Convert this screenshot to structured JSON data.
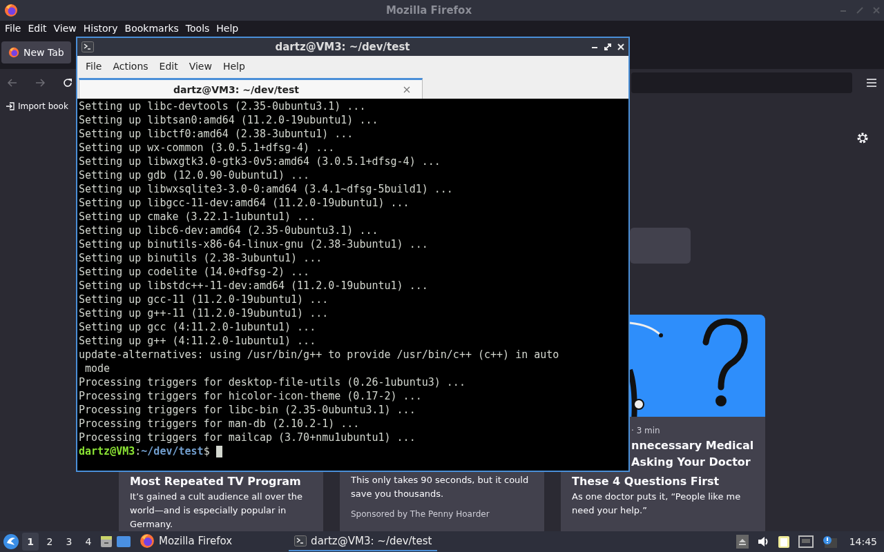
{
  "firefox": {
    "title": "Mozilla Firefox",
    "menu": [
      "File",
      "Edit",
      "View",
      "History",
      "Bookmarks",
      "Tools",
      "Help"
    ],
    "tabs": [
      {
        "label": "New Tab",
        "selected": true
      }
    ],
    "bookmarks": [
      {
        "label": "Import book"
      }
    ],
    "cards": [
      {
        "title_lines": [
          "Most Repeated TV Program"
        ],
        "text": "It’s gained a cult audience all over the world—and is especially popular in Germany.",
        "picture": false
      },
      {
        "text": "This only takes 90 seconds, but it could save you thousands.",
        "sponsor": "Sponsored by The Penny Hoarder",
        "picture": false
      },
      {
        "meta": "· 3 min",
        "cut_lines": [
          "nnecessary Medical",
          "Asking Your Doctor"
        ],
        "title_lines": [
          "These 4 Questions First"
        ],
        "text": "As one doctor puts it, “People like me need your help.”",
        "picture": true
      }
    ]
  },
  "terminal": {
    "title": "dartz@VM3: ~/dev/test",
    "menu": [
      "File",
      "Actions",
      "Edit",
      "View",
      "Help"
    ],
    "tabs": [
      {
        "label": "dartz@VM3: ~/dev/test",
        "selected": true
      }
    ],
    "lines": [
      "Setting up libc-devtools (2.35-0ubuntu3.1) ...",
      "Setting up libtsan0:amd64 (11.2.0-19ubuntu1) ...",
      "Setting up libctf0:amd64 (2.38-3ubuntu1) ...",
      "Setting up wx-common (3.0.5.1+dfsg-4) ...",
      "Setting up libwxgtk3.0-gtk3-0v5:amd64 (3.0.5.1+dfsg-4) ...",
      "Setting up gdb (12.0.90-0ubuntu1) ...",
      "Setting up libwxsqlite3-3.0-0:amd64 (3.4.1~dfsg-5build1) ...",
      "Setting up libgcc-11-dev:amd64 (11.2.0-19ubuntu1) ...",
      "Setting up cmake (3.22.1-1ubuntu1) ...",
      "Setting up libc6-dev:amd64 (2.35-0ubuntu3.1) ...",
      "Setting up binutils-x86-64-linux-gnu (2.38-3ubuntu1) ...",
      "Setting up binutils (2.38-3ubuntu1) ...",
      "Setting up codelite (14.0+dfsg-2) ...",
      "Setting up libstdc++-11-dev:amd64 (11.2.0-19ubuntu1) ...",
      "Setting up gcc-11 (11.2.0-19ubuntu1) ...",
      "Setting up g++-11 (11.2.0-19ubuntu1) ...",
      "Setting up gcc (4:11.2.0-1ubuntu1) ...",
      "Setting up g++ (4:11.2.0-1ubuntu1) ...",
      "update-alternatives: using /usr/bin/g++ to provide /usr/bin/c++ (c++) in auto",
      " mode",
      "Processing triggers for desktop-file-utils (0.26-1ubuntu3) ...",
      "Processing triggers for hicolor-icon-theme (0.17-2) ...",
      "Processing triggers for libc-bin (2.35-0ubuntu3.1) ...",
      "Processing triggers for man-db (2.10.2-1) ...",
      "Processing triggers for mailcap (3.70+nmu1ubuntu1) ..."
    ],
    "prompt": {
      "user_host": "dartz@VM3",
      "sep": ":",
      "path": "~/dev/test",
      "symbol": "$"
    }
  },
  "taskbar": {
    "workspaces": [
      {
        "label": "1",
        "selected": true
      },
      {
        "label": "2",
        "selected": false
      },
      {
        "label": "3",
        "selected": false
      },
      {
        "label": "4",
        "selected": false
      }
    ],
    "tasks": [
      {
        "label": "Mozilla Firefox",
        "kind": "firefox",
        "selected": false
      },
      {
        "label": "dartz@VM3: ~/dev/test",
        "kind": "terminal",
        "selected": true
      }
    ],
    "clock": "14:45"
  }
}
